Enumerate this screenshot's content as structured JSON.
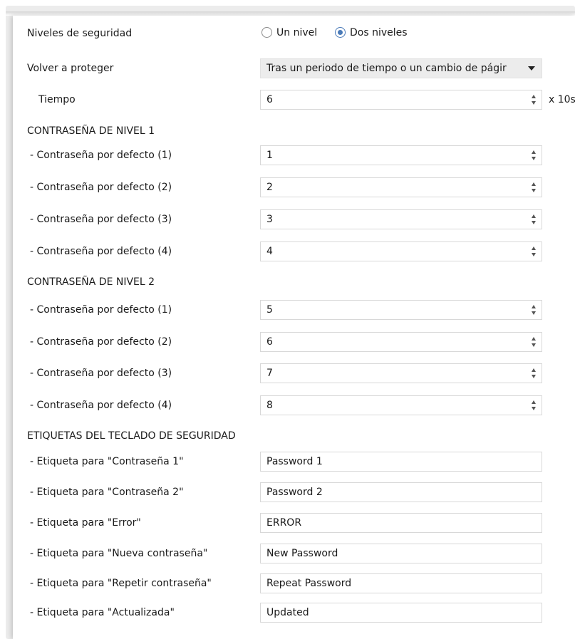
{
  "security_levels": {
    "label": "Niveles de seguridad",
    "options": [
      {
        "label": "Un nivel",
        "selected": false
      },
      {
        "label": "Dos niveles",
        "selected": true
      }
    ]
  },
  "reprotect": {
    "label": "Volver a proteger",
    "value": "Tras un periodo de tiempo o un cambio de págir"
  },
  "time": {
    "label": "Tiempo",
    "value": "6",
    "unit": "x 10s"
  },
  "level1": {
    "title": "CONTRASEÑA DE NIVEL 1",
    "rows": [
      {
        "label": "- Contraseña por defecto (1)",
        "value": "1"
      },
      {
        "label": "- Contraseña por defecto (2)",
        "value": "2"
      },
      {
        "label": "- Contraseña por defecto (3)",
        "value": "3"
      },
      {
        "label": "- Contraseña por defecto (4)",
        "value": "4"
      }
    ]
  },
  "level2": {
    "title": "CONTRASEÑA DE NIVEL 2",
    "rows": [
      {
        "label": "- Contraseña por defecto (1)",
        "value": "5"
      },
      {
        "label": "- Contraseña por defecto (2)",
        "value": "6"
      },
      {
        "label": "- Contraseña por defecto (3)",
        "value": "7"
      },
      {
        "label": "- Contraseña por defecto (4)",
        "value": "8"
      }
    ]
  },
  "keypad_labels": {
    "title": "ETIQUETAS DEL TECLADO DE SEGURIDAD",
    "rows": [
      {
        "label": "- Etiqueta para \"Contraseña 1\"",
        "value": "Password 1"
      },
      {
        "label": "- Etiqueta para \"Contraseña 2\"",
        "value": "Password 2"
      },
      {
        "label": "- Etiqueta para \"Error\"",
        "value": "ERROR"
      },
      {
        "label": "- Etiqueta para \"Nueva contraseña\"",
        "value": "New Password"
      },
      {
        "label": "- Etiqueta para \"Repetir contraseña\"",
        "value": "Repeat Password"
      },
      {
        "label": "- Etiqueta para \"Actualizada\"",
        "value": "Updated"
      }
    ]
  }
}
